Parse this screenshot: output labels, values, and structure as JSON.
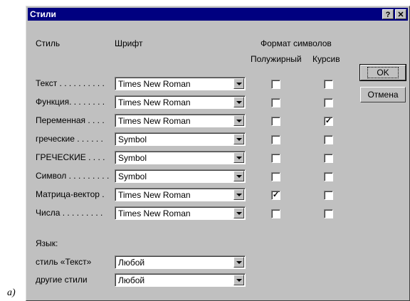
{
  "window": {
    "title": "Стили",
    "help_glyph": "?",
    "close_glyph": "✕"
  },
  "headers": {
    "style": "Стиль",
    "font": "Шрифт",
    "format": "Формат символов",
    "bold": "Полужирный",
    "italic": "Курсив"
  },
  "rows": [
    {
      "label": "Текст . . . . . . . . . .",
      "font": "Times New Roman",
      "bold": "",
      "italic": ""
    },
    {
      "label": "Функция. . . . . . . .",
      "font": "Times New Roman",
      "bold": "",
      "italic": ""
    },
    {
      "label": "Переменная . . . .",
      "font": "Times New Roman",
      "bold": "",
      "italic": "✓"
    },
    {
      "label": "греческие . . . . . .",
      "font": "Symbol",
      "bold": "",
      "italic": ""
    },
    {
      "label": "ГРЕЧЕСКИЕ . . . .",
      "font": "Symbol",
      "bold": "",
      "italic": ""
    },
    {
      "label": "Символ . . . . . . . . .",
      "font": "Symbol",
      "bold": "",
      "italic": ""
    },
    {
      "label": "Матрица-вектор .",
      "font": "Times New Roman",
      "bold": "✓",
      "italic": ""
    },
    {
      "label": "Числа . . . . . . . . .",
      "font": "Times New Roman",
      "bold": "",
      "italic": ""
    }
  ],
  "language": {
    "title": "Язык:",
    "text_style_label": "стиль «Текст»",
    "text_style_value": "Любой",
    "other_label": "другие стили",
    "other_value": "Любой"
  },
  "buttons": {
    "ok": "OK",
    "cancel": "Отмена"
  },
  "caption": "а)"
}
